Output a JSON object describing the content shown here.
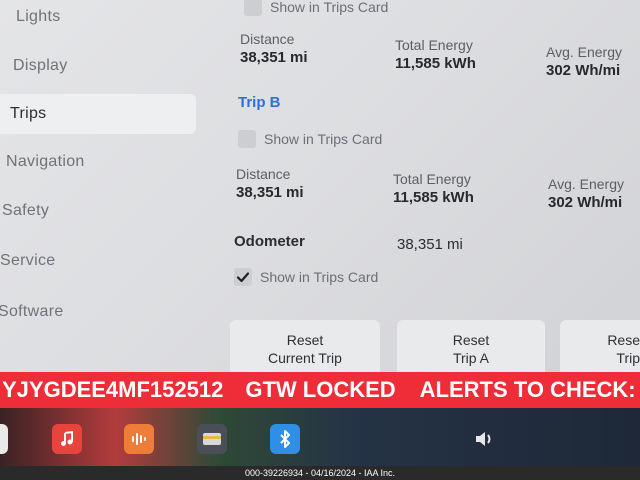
{
  "sidebar": {
    "items": [
      {
        "label": "Lights"
      },
      {
        "label": "Display"
      },
      {
        "label": "Trips"
      },
      {
        "label": "Navigation"
      },
      {
        "label": "Safety"
      },
      {
        "label": "Service"
      },
      {
        "label": "Software"
      }
    ]
  },
  "trip_a": {
    "show_label": "Show in Trips Card",
    "distance_label": "Distance",
    "distance_value": "38,351 mi",
    "energy_label": "Total Energy",
    "energy_value": "11,585 kWh",
    "avg_label": "Avg. Energy",
    "avg_value": "302 Wh/mi"
  },
  "trip_b": {
    "title": "Trip B",
    "show_label": "Show in Trips Card",
    "distance_label": "Distance",
    "distance_value": "38,351 mi",
    "energy_label": "Total Energy",
    "energy_value": "11,585 kWh",
    "avg_label": "Avg. Energy",
    "avg_value": "302 Wh/mi"
  },
  "odometer": {
    "label": "Odometer",
    "value": "38,351 mi",
    "show_label": "Show in Trips Card",
    "show_checked": true
  },
  "buttons": {
    "reset_current_line1": "Reset",
    "reset_current_line2": "Current Trip",
    "reset_a_line1": "Reset",
    "reset_a_line2": "Trip A",
    "reset_b_line1": "Rese",
    "reset_b_line2": "Trip"
  },
  "banner": {
    "vin": "YJYGDEE4MF152512",
    "status": "GTW LOCKED",
    "alerts": "ALERTS TO CHECK:"
  },
  "dock": {
    "icons": [
      "music-icon",
      "audio-wave-icon",
      "card-icon",
      "bluetooth-icon",
      "volume-icon"
    ]
  },
  "footer": {
    "text": "000-39226934 - 04/16/2024 - IAA Inc."
  },
  "colors": {
    "accent_blue": "#2f6fd6",
    "banner_red": "#ee2d39"
  }
}
